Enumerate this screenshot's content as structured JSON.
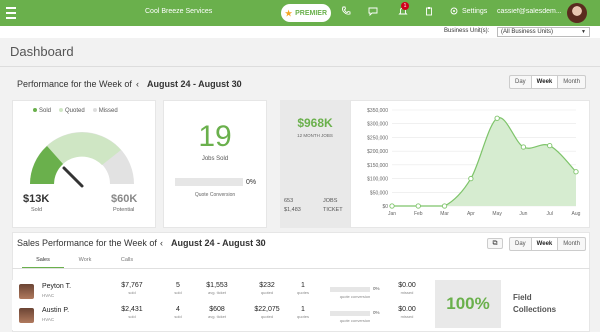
{
  "topbar": {
    "app_title": "Cool Breeze Services",
    "premier_label": "PREMIER",
    "notification_count": "1",
    "settings_label": "Settings",
    "user_email": "cassief@salesdem..."
  },
  "business_units": {
    "label": "Business Unit(s):",
    "selected": "(All Business Units)"
  },
  "page_title": "Dashboard",
  "performance": {
    "title": "Performance for the Week of",
    "range": "August 24 - August 30",
    "prev": "‹",
    "next": "›",
    "periods": [
      "Day",
      "Week",
      "Month"
    ],
    "active_period": "Week"
  },
  "gauge": {
    "legend": [
      "Sold",
      "Quoted",
      "Missed"
    ],
    "sold_value": "$13K",
    "sold_label": "Sold",
    "potential_value": "$60K",
    "potential_label": "Potential"
  },
  "jobs": {
    "count": "19",
    "label": "Jobs Sold",
    "quote_pct": "0%",
    "quote_label": "Quote Conversion"
  },
  "revenue": {
    "total": "$968K",
    "total_label": "12 MONTH JOBS",
    "jobs": "653",
    "jobs_label": "JOBS",
    "ticket": "$1,483",
    "ticket_label": "TICKET"
  },
  "chart_data": {
    "type": "area",
    "x": [
      "Jan",
      "Feb",
      "Mar",
      "Apr",
      "May",
      "Jun",
      "Jul",
      "Aug"
    ],
    "values": [
      0,
      0,
      0,
      100000,
      320000,
      215000,
      220000,
      125000
    ],
    "ylim": [
      0,
      350000
    ],
    "yticks": [
      "$0",
      "$50,000",
      "$100,000",
      "$150,000",
      "$200,000",
      "$250,000",
      "$300,000",
      "$350,000"
    ],
    "colors": {
      "line": "#7ec46a",
      "fill": "#d6ecd0",
      "grid": "#e8e8e8"
    }
  },
  "sales": {
    "title": "Sales Performance for the Week of",
    "range": "August 24 - August 30",
    "periods": [
      "Day",
      "Week",
      "Month"
    ],
    "active_period": "Week",
    "tabs": [
      "Sales",
      "Work",
      "Calls"
    ],
    "active_tab": "Sales",
    "rows": [
      {
        "name": "Peyton T.",
        "role": "HVAC",
        "sold": "$7,767",
        "sold_label": "sold",
        "jobs": "5",
        "jobs_label": "sold",
        "avg": "$1,553",
        "avg_label": "avg. ticket",
        "quoted": "$232",
        "quoted_label": "quoted",
        "quotes": "1",
        "quotes_label": "quotes",
        "conv_pct": "0%",
        "conv_label": "quote conversion",
        "missed": "$0.00",
        "missed_label": "missed"
      },
      {
        "name": "Austin P.",
        "role": "HVAC",
        "sold": "$2,431",
        "sold_label": "sold",
        "jobs": "4",
        "jobs_label": "sold",
        "avg": "$608",
        "avg_label": "avg. ticket",
        "quoted": "$22,075",
        "quoted_label": "quoted",
        "quotes": "1",
        "quotes_label": "quotes",
        "conv_pct": "0%",
        "conv_label": "quote conversion",
        "missed": "$0.00",
        "missed_label": "missed"
      }
    ],
    "field_collections_pct": "100%",
    "field_collections_label": "Field Collections"
  }
}
